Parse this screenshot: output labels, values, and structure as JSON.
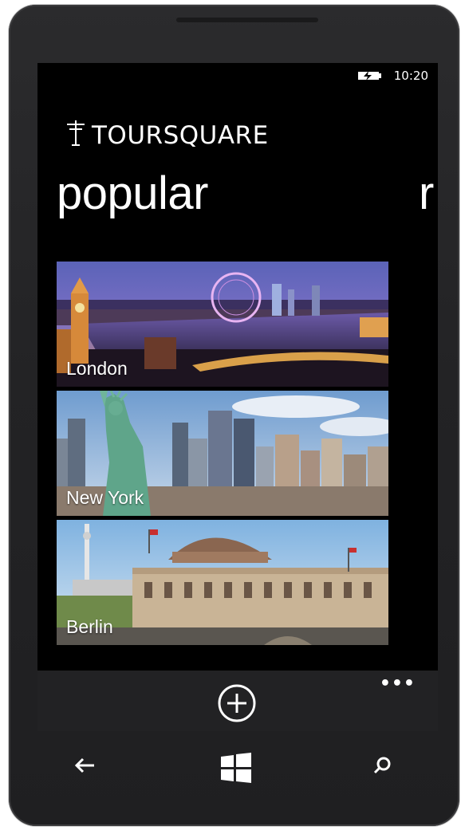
{
  "status": {
    "time": "10:20",
    "battery_icon": "battery-charging-icon"
  },
  "app": {
    "title": "TOURSQUARE",
    "logo_icon": "signpost-icon"
  },
  "pivot": {
    "current": "popular",
    "next_peek": "r"
  },
  "cities": [
    {
      "name": "London"
    },
    {
      "name": "New York"
    },
    {
      "name": "Berlin"
    }
  ],
  "appbar": {
    "add_icon": "add-icon",
    "more_label": "•••"
  },
  "hardware": {
    "back_icon": "back-arrow-icon",
    "start_icon": "windows-start-icon",
    "search_icon": "search-icon"
  }
}
